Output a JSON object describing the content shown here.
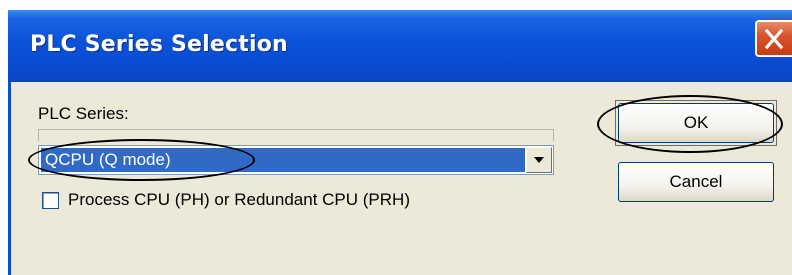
{
  "window": {
    "title": "PLC Series Selection",
    "close_icon": "close-x-icon"
  },
  "form": {
    "series_label": "PLC Series:",
    "series_value": "QCPU (Q mode)",
    "dropdown_icon": "chevron-down-icon",
    "checkbox_label": "Process CPU (PH) or Redundant CPU (PRH)",
    "checkbox_checked": false
  },
  "buttons": {
    "ok_label": "OK",
    "cancel_label": "Cancel"
  },
  "annotations": {
    "highlight_color": "#000000"
  },
  "colors": {
    "titlebar": "#0b52d8",
    "selection": "#316ac5",
    "close_button": "#d9552e",
    "dialog_face": "#ece9d8"
  }
}
